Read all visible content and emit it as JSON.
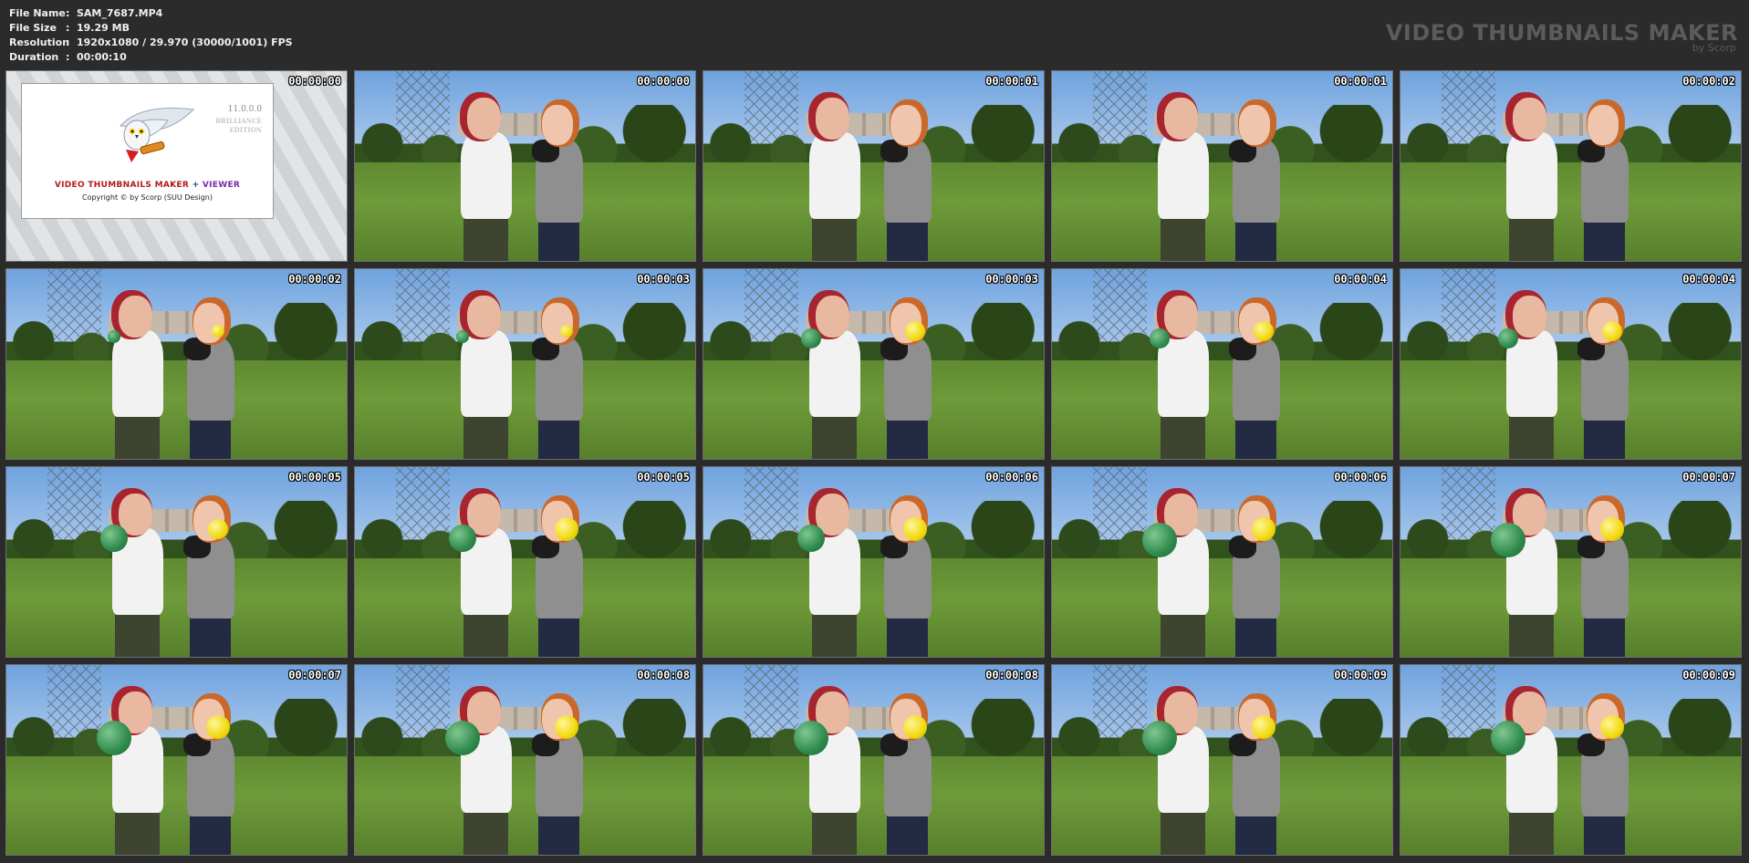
{
  "header": {
    "rows": [
      {
        "key": "File Name",
        "sep": ":",
        "value": "SAM_7687.MP4"
      },
      {
        "key": "File Size",
        "sep": ":",
        "value": "19.29 MB"
      },
      {
        "key": "Resolution",
        "sep": ":",
        "value": "1920x1080 / 29.970 (30000/1001) FPS"
      },
      {
        "key": "Duration",
        "sep": ":",
        "value": "00:00:10"
      }
    ],
    "brand_title": "VIDEO THUMBNAILS MAKER",
    "brand_sub": "by Scorp"
  },
  "logo": {
    "version": "11.0.0.0",
    "edition": "BRILLIANCE EDITION",
    "product_part1": "VIDEO THUMBNAILS MAKER",
    "product_part2": " + ",
    "product_part3": "VIEWER",
    "copyright": "Copyright © by Scorp (SUU Design)"
  },
  "thumbnails": [
    {
      "timecode": "00:00:00",
      "green": 0,
      "yellow": 0
    },
    {
      "timecode": "00:00:00",
      "green": 0,
      "yellow": 0
    },
    {
      "timecode": "00:00:01",
      "green": 0,
      "yellow": 0
    },
    {
      "timecode": "00:00:01",
      "green": 0,
      "yellow": 0
    },
    {
      "timecode": "00:00:02",
      "green": 0,
      "yellow": 0
    },
    {
      "timecode": "00:00:02",
      "green": 1,
      "yellow": 1
    },
    {
      "timecode": "00:00:03",
      "green": 1,
      "yellow": 1
    },
    {
      "timecode": "00:00:03",
      "green": 2,
      "yellow": 2
    },
    {
      "timecode": "00:00:04",
      "green": 2,
      "yellow": 2
    },
    {
      "timecode": "00:00:04",
      "green": 2,
      "yellow": 2
    },
    {
      "timecode": "00:00:05",
      "green": 3,
      "yellow": 2
    },
    {
      "timecode": "00:00:05",
      "green": 3,
      "yellow": 3
    },
    {
      "timecode": "00:00:06",
      "green": 3,
      "yellow": 3
    },
    {
      "timecode": "00:00:06",
      "green": 4,
      "yellow": 3
    },
    {
      "timecode": "00:00:07",
      "green": 4,
      "yellow": 3
    },
    {
      "timecode": "00:00:07",
      "green": 4,
      "yellow": 3
    },
    {
      "timecode": "00:00:08",
      "green": 4,
      "yellow": 3
    },
    {
      "timecode": "00:00:08",
      "green": 4,
      "yellow": 3
    },
    {
      "timecode": "00:00:09",
      "green": 4,
      "yellow": 3
    },
    {
      "timecode": "00:00:09",
      "green": 4,
      "yellow": 3
    }
  ]
}
